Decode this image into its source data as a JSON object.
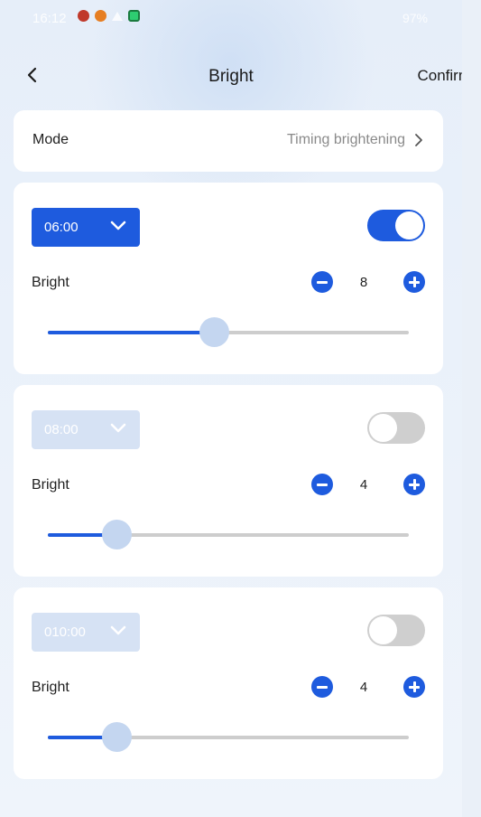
{
  "status_bar": {
    "time": "16:12",
    "battery": "97%"
  },
  "header": {
    "title": "Bright",
    "confirm_label": "Confirm"
  },
  "mode": {
    "label": "Mode",
    "value": "Timing brightening"
  },
  "timers": [
    {
      "time": "06:00",
      "enabled": true,
      "bright_label": "Bright",
      "value": "8",
      "level_fraction": 0.46
    },
    {
      "time": "08:00",
      "enabled": false,
      "bright_label": "Bright",
      "value": "4",
      "level_fraction": 0.19
    },
    {
      "time": "010:00",
      "enabled": false,
      "bright_label": "Bright",
      "value": "4",
      "level_fraction": 0.19
    }
  ],
  "colors": {
    "accent": "#1e5bde",
    "disabled": "#d6e2f4",
    "toggle_off": "#cfcfcf",
    "thumb": "#c4d6f0"
  }
}
